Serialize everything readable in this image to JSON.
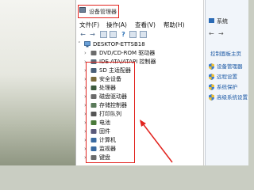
{
  "window": {
    "title": "设备管理器",
    "menu": [
      "文件(F)",
      "操作(A)",
      "查看(V)",
      "帮助(H)"
    ]
  },
  "toolbar": {
    "back_icon": "arrow-left-icon",
    "forward_icon": "arrow-right-icon"
  },
  "tree": {
    "root": "DESKTOP-ETTSB18",
    "items": [
      {
        "label": "DVD/CD-ROM 驱动器",
        "icon": "dvd-drive-icon",
        "color": "#6b6b6b"
      },
      {
        "label": "IDE ATA/ATAPI 控制器",
        "icon": "ide-controller-icon",
        "color": "#5a6b7a"
      },
      {
        "label": "SD 主适配器",
        "icon": "sd-adapter-icon",
        "color": "#4a5f78"
      },
      {
        "label": "安全设备",
        "icon": "security-device-icon",
        "color": "#7a6a3a"
      },
      {
        "label": "处理器",
        "icon": "processor-icon",
        "color": "#3c5a3c"
      },
      {
        "label": "磁盘驱动器",
        "icon": "disk-drive-icon",
        "color": "#6a6a6a"
      },
      {
        "label": "存储控制器",
        "icon": "storage-controller-icon",
        "color": "#5a7a5a"
      },
      {
        "label": "打印队列",
        "icon": "print-queue-icon",
        "color": "#555555"
      },
      {
        "label": "电池",
        "icon": "battery-icon",
        "color": "#4a7a3a"
      },
      {
        "label": "固件",
        "icon": "firmware-icon",
        "color": "#5a5a7a"
      },
      {
        "label": "计算机",
        "icon": "computer-icon",
        "color": "#3a6aa0"
      },
      {
        "label": "监视器",
        "icon": "monitor-icon",
        "color": "#3a6aa0"
      },
      {
        "label": "键盘",
        "icon": "keyboard-icon",
        "color": "#6a6a6a"
      }
    ]
  },
  "system_panel": {
    "title": "系统",
    "home_link": "控制面板主页",
    "links": [
      {
        "label": "设备管理器",
        "icon": "shield-icon"
      },
      {
        "label": "远程设置",
        "icon": "shield-icon"
      },
      {
        "label": "系统保护",
        "icon": "shield-icon"
      },
      {
        "label": "高级系统设置",
        "icon": "shield-icon"
      }
    ]
  },
  "colors": {
    "annotation_red": "#e2241f",
    "link_blue": "#1a57a3"
  }
}
